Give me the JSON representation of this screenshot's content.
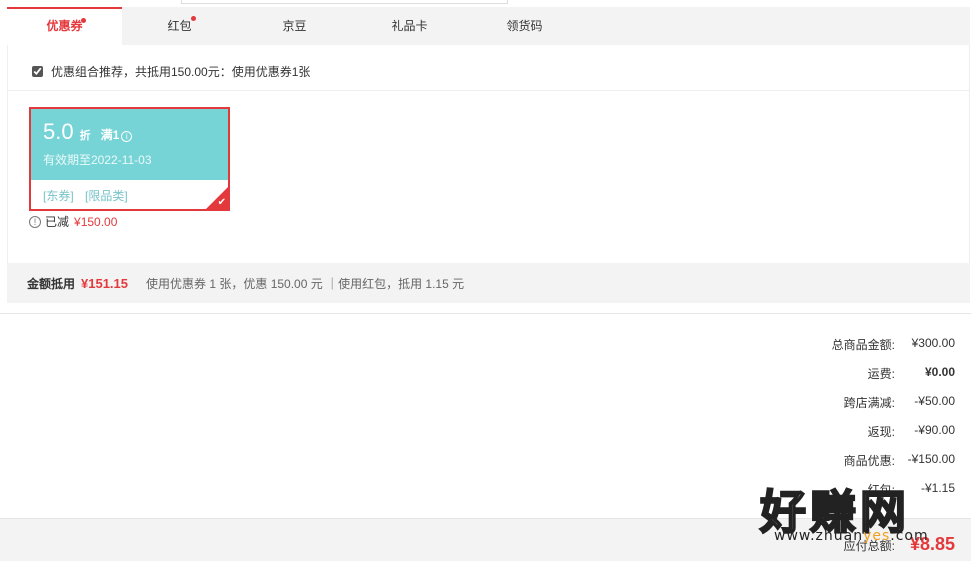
{
  "tabs": [
    {
      "label": "优惠券",
      "active": true,
      "dot": true
    },
    {
      "label": "红包",
      "active": false,
      "dot": true
    },
    {
      "label": "京豆",
      "active": false,
      "dot": false
    },
    {
      "label": "礼品卡",
      "active": false,
      "dot": false
    },
    {
      "label": "领货码",
      "active": false,
      "dot": false
    }
  ],
  "combo": {
    "checked": true,
    "text": "优惠组合推荐，共抵用150.00元：使用优惠券1张"
  },
  "coupon": {
    "amount": "5.0",
    "unit": "折",
    "condition": "满1",
    "validity": "有效期至2022-11-03",
    "tags": [
      "[东券]",
      "[限品类]"
    ],
    "selected": true,
    "colors": {
      "card": "#76d3d6",
      "border": "#e4393c"
    }
  },
  "reduced": {
    "label": "已减",
    "amount": "¥150.00"
  },
  "summary": {
    "label": "金额抵用",
    "amount": "¥151.15",
    "detail": "使用优惠券 1 张，优惠 150.00 元 ｜使用红包，抵用 1.15 元"
  },
  "totals": [
    {
      "label": "总商品金额:",
      "value": "¥300.00"
    },
    {
      "label": "运费:",
      "value": "¥0.00"
    },
    {
      "label": "跨店满减:",
      "value": "-¥50.00"
    },
    {
      "label": "返现:",
      "value": "-¥90.00"
    },
    {
      "label": "商品优惠:",
      "value": "-¥150.00"
    },
    {
      "label": "红包:",
      "value": "-¥1.15"
    }
  ],
  "payable": {
    "label": "应付总额:",
    "value": "¥8.85"
  },
  "watermark": {
    "text": "好赚网",
    "url_prefix": "www.zhuan",
    "url_highlight": "yes",
    "url_suffix": ".com"
  },
  "colors": {
    "accent": "#e4393c",
    "coupon": "#76d3d6",
    "bar": "#f3f3f3"
  }
}
